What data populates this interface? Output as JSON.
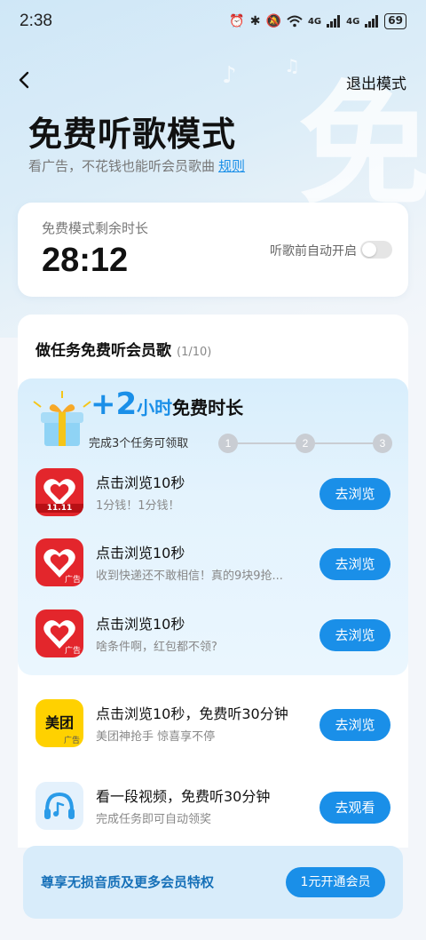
{
  "status_bar": {
    "time": "2:38",
    "network_label": "4G",
    "network_label_2": "4G",
    "battery": "69"
  },
  "header": {
    "exit_label": "退出模式",
    "title": "免费听歌模式",
    "subtitle": "看广告，不花钱也能听会员歌曲",
    "rules_label": "规则",
    "decor_glyph": "免"
  },
  "time_card": {
    "label": "免费模式剩余时长",
    "value": "28:12",
    "auto_label": "听歌前自动开启",
    "auto_enabled": false
  },
  "tasks": {
    "title": "做任务免费听会员歌",
    "progress": "(1/10)",
    "bonus": {
      "plus": "+2",
      "unit": "小时",
      "text": "免费时长",
      "sub": "完成3个任务可领取",
      "steps": [
        "1",
        "2",
        "3"
      ]
    },
    "items": [
      {
        "name": "点击浏览10秒",
        "desc": "1分钱！1分钱！",
        "action": "去浏览",
        "icon": "pinduoduo-icon",
        "sale_tag": "11.11",
        "ad_tag": "广告"
      },
      {
        "name": "点击浏览10秒",
        "desc": "收到快递还不敢相信！真的9块9抢...",
        "action": "去浏览",
        "icon": "pinduoduo-icon",
        "ad_tag": "广告"
      },
      {
        "name": "点击浏览10秒",
        "desc": "啥条件啊，红包都不领?",
        "action": "去浏览",
        "icon": "pinduoduo-icon",
        "ad_tag": "广告"
      },
      {
        "name": "点击浏览10秒，免费听30分钟",
        "desc": "美团神抢手 惊喜享不停",
        "action": "去浏览",
        "icon": "meituan-icon",
        "brand": "美团",
        "ad_tag": "广告"
      },
      {
        "name": "看一段视频，免费听30分钟",
        "desc": "完成任务即可自动领奖",
        "action": "去观看",
        "icon": "headphones-music-icon"
      }
    ]
  },
  "vip_bar": {
    "text": "尊享无损音质及更多会员特权",
    "button": "1元开通会员"
  },
  "colors": {
    "accent": "#1a8fe8",
    "brand_red": "#e3262c",
    "brand_yellow": "#ffd100"
  }
}
